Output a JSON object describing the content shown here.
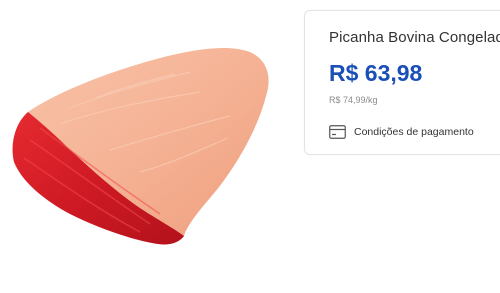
{
  "product": {
    "name": "Picanha Bovina Congelada",
    "price": "R$ 63,98",
    "unit_price": "R$ 74,99/kg",
    "payment_conditions_label": "Condições de pagamento",
    "payment_icon": "credit-card-icon"
  },
  "colors": {
    "price": "#1a4fb8",
    "fat": "#f5b79b",
    "meat": "#d8202a"
  }
}
